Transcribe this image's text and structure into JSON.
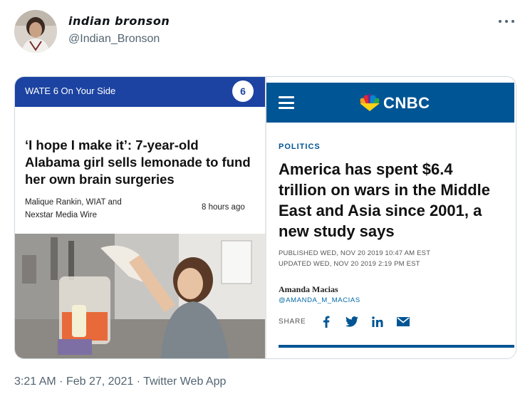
{
  "tweet": {
    "display_name": "indian bronson",
    "handle": "@Indian_Bronson",
    "more_icon": "more-horizontal-icon",
    "time": "3:21 AM",
    "date": "Feb 27, 2021",
    "app": "Twitter Web App",
    "separator": "·"
  },
  "left_card": {
    "station_text": "WATE 6 On Your Side",
    "station_logo": "6",
    "headline": "‘I hope I make it’: 7-year-old Alabama girl sells lemonade to fund her own brain surgeries",
    "byline": "Malique Rankin, WIAT and Nexstar Media Wire",
    "time_ago": "8 hours ago",
    "brand_color": "#1c43a1"
  },
  "right_card": {
    "brand": "CNBC",
    "category": "POLITICS",
    "headline_lines": [
      "America has spent $6.4",
      "trillion on wars in the Middle",
      "East and Asia since 2001, a",
      "new study says"
    ],
    "published": "PUBLISHED WED, NOV 20 2019 10:47 AM EST",
    "updated": "UPDATED WED, NOV 20 2019 2:19 PM EST",
    "author": "Amanda Macias",
    "author_twitter": "@AMANDA_M_MACIAS",
    "share_label": "SHARE",
    "share_icons": [
      "facebook-icon",
      "twitter-icon",
      "linkedin-icon",
      "email-icon"
    ],
    "brand_color": "#005594"
  }
}
